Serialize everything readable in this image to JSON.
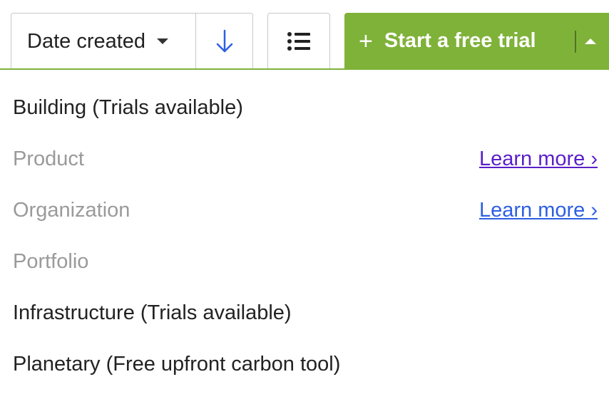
{
  "toolbar": {
    "sort_select_value": "Date created",
    "sort_direction_icon": "arrow-down-icon",
    "view_icon": "list-icon",
    "trial_button_label": "Start a free trial",
    "trial_button_icon": "plus-icon",
    "colors": {
      "accent": "#7fb239",
      "arrow": "#2d5fe3"
    }
  },
  "menu": {
    "items": [
      {
        "label": "Building (Trials available)",
        "enabled": true,
        "link": ""
      },
      {
        "label": "Product",
        "enabled": false,
        "link": "Learn more ›"
      },
      {
        "label": "Organization",
        "enabled": false,
        "link": "Learn more ›"
      },
      {
        "label": "Portfolio",
        "enabled": false,
        "link": ""
      },
      {
        "label": "Infrastructure (Trials available)",
        "enabled": true,
        "link": ""
      },
      {
        "label": "Planetary (Free upfront carbon tool)",
        "enabled": true,
        "link": ""
      }
    ]
  }
}
